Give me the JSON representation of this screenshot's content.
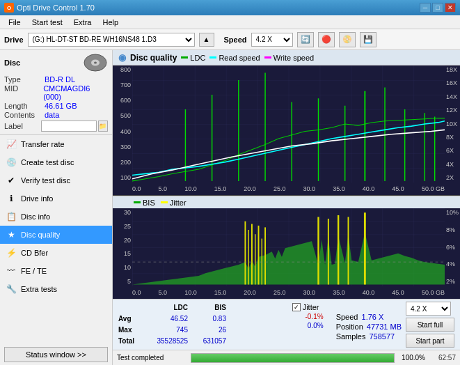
{
  "titlebar": {
    "title": "Opti Drive Control 1.70",
    "icon": "O",
    "btn_minimize": "─",
    "btn_maximize": "□",
    "btn_close": "✕"
  },
  "menubar": {
    "items": [
      "File",
      "Start test",
      "Extra",
      "Help"
    ]
  },
  "drivebar": {
    "drive_label": "Drive",
    "drive_value": "(G:)  HL-DT-ST BD-RE  WH16NS48 1.D3",
    "speed_label": "Speed",
    "speed_value": "4.2 X"
  },
  "disc": {
    "title": "Disc",
    "type_label": "Type",
    "type_value": "BD-R DL",
    "mid_label": "MID",
    "mid_value": "CMCMAGDI6 (000)",
    "length_label": "Length",
    "length_value": "46.61 GB",
    "contents_label": "Contents",
    "contents_value": "data",
    "label_label": "Label"
  },
  "nav": {
    "items": [
      {
        "id": "transfer-rate",
        "label": "Transfer rate",
        "icon": "📈",
        "active": false
      },
      {
        "id": "create-test-disc",
        "label": "Create test disc",
        "icon": "💿",
        "active": false
      },
      {
        "id": "verify-test-disc",
        "label": "Verify test disc",
        "icon": "✔",
        "active": false
      },
      {
        "id": "drive-info",
        "label": "Drive info",
        "icon": "ℹ",
        "active": false
      },
      {
        "id": "disc-info",
        "label": "Disc info",
        "icon": "📋",
        "active": false
      },
      {
        "id": "disc-quality",
        "label": "Disc quality",
        "icon": "★",
        "active": true
      },
      {
        "id": "cd-bfer",
        "label": "CD Bfer",
        "icon": "⚡",
        "active": false
      },
      {
        "id": "fe-te",
        "label": "FE / TE",
        "icon": "〰",
        "active": false
      },
      {
        "id": "extra-tests",
        "label": "Extra tests",
        "icon": "🔧",
        "active": false
      }
    ]
  },
  "status_btn": "Status window >>",
  "chart": {
    "title": "Disc quality",
    "legend_ldc": "LDC",
    "legend_read": "Read speed",
    "legend_write": "Write speed",
    "upper_y_labels": [
      "800",
      "700",
      "600",
      "500",
      "400",
      "300",
      "200",
      "100"
    ],
    "upper_y_right": [
      "18X",
      "16X",
      "14X",
      "12X",
      "10X",
      "8X",
      "6X",
      "4X",
      "2X"
    ],
    "lower_y_labels": [
      "30",
      "25",
      "20",
      "15",
      "10",
      "5"
    ],
    "lower_y_right": [
      "10%",
      "8%",
      "6%",
      "4%",
      "2%"
    ],
    "x_labels_upper": [
      "0.0",
      "5.0",
      "10.0",
      "15.0",
      "20.0",
      "25.0",
      "30.0",
      "35.0",
      "40.0",
      "45.0",
      "50.0 GB"
    ],
    "x_labels_lower": [
      "0.0",
      "5.0",
      "10.0",
      "15.0",
      "20.0",
      "25.0",
      "30.0",
      "35.0",
      "40.0",
      "45.0",
      "50.0 GB"
    ],
    "lower_legend_bis": "BIS",
    "lower_legend_jitter": "Jitter"
  },
  "stats": {
    "col_headers": [
      "",
      "LDC",
      "BIS",
      "",
      "Jitter",
      "Speed"
    ],
    "avg_label": "Avg",
    "avg_ldc": "46.52",
    "avg_bis": "0.83",
    "avg_jitter": "-0.1%",
    "max_label": "Max",
    "max_ldc": "745",
    "max_bis": "26",
    "max_jitter": "0.0%",
    "total_label": "Total",
    "total_ldc": "35528525",
    "total_bis": "631057",
    "speed_label": "Speed",
    "speed_value": "1.76 X",
    "speed_select": "4.2 X",
    "position_label": "Position",
    "position_value": "47731 MB",
    "samples_label": "Samples",
    "samples_value": "758577",
    "btn_start_full": "Start full",
    "btn_start_part": "Start part",
    "jitter_checked": true
  },
  "progress": {
    "status_text": "Test completed",
    "percent": "100.0%",
    "time_elapsed": "62:57"
  }
}
